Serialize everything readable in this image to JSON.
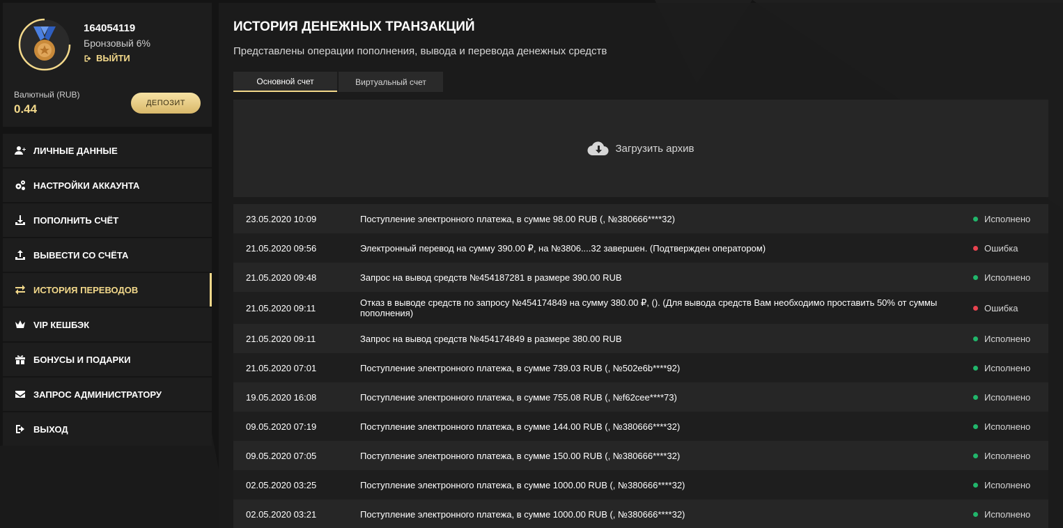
{
  "profile": {
    "user_id": "164054119",
    "level": "Бронзовый 6%",
    "logout_label": "ВЫЙТИ",
    "balance_label": "Валютный (RUB)",
    "balance_value": "0.44",
    "deposit_label": "ДЕПОЗИТ"
  },
  "menu": [
    {
      "label": "ЛИЧНЫЕ ДАННЫЕ",
      "icon": "user-plus-icon"
    },
    {
      "label": "НАСТРОЙКИ АККАУНТА",
      "icon": "gears-icon"
    },
    {
      "label": "ПОПОЛНИТЬ СЧЁТ",
      "icon": "download-icon"
    },
    {
      "label": "ВЫВЕСТИ СО СЧЁТА",
      "icon": "upload-icon"
    },
    {
      "label": "ИСТОРИЯ ПЕРЕВОДОВ",
      "icon": "exchange-icon",
      "active": true
    },
    {
      "label": "VIP КЕШБЭК",
      "icon": "crown-icon"
    },
    {
      "label": "БОНУСЫ И ПОДАРКИ",
      "icon": "gift-icon"
    },
    {
      "label": "ЗАПРОС АДМИНИСТРАТОРУ",
      "icon": "envelope-icon"
    },
    {
      "label": "ВЫХОД",
      "icon": "sign-out-icon"
    }
  ],
  "main": {
    "title": "ИСТОРИЯ ДЕНЕЖНЫХ ТРАНЗАКЦИЙ",
    "subtitle": "Представлены операции пополнения, вывода и перевода денежных средств",
    "tabs": [
      {
        "label": "Основной счет",
        "active": true
      },
      {
        "label": "Виртуальный счет",
        "active": false
      }
    ],
    "archive_label": "Загрузить архив"
  },
  "status_colors": {
    "success": "#21b66b",
    "error": "#e8434f"
  },
  "transactions": [
    {
      "date": "23.05.2020 10:09",
      "desc": "Поступление электронного платежа, в сумме 98.00 RUB (, №380666****32)",
      "status": "Исполнено",
      "kind": "success"
    },
    {
      "date": "21.05.2020 09:56",
      "desc": "Электронный перевод на сумму 390.00 ₽, на №3806....32 завершен. (Подтвержден оператором)",
      "status": "Ошибка",
      "kind": "error"
    },
    {
      "date": "21.05.2020 09:48",
      "desc": "Запрос на вывод средств №454187281 в размере 390.00 RUB",
      "status": "Исполнено",
      "kind": "success"
    },
    {
      "date": "21.05.2020 09:11",
      "desc": "Отказ в выводе средств по запросу №454174849 на сумму 380.00 ₽, (). (Для вывода средств Вам необходимо проставить 50% от суммы пополнения)",
      "status": "Ошибка",
      "kind": "error",
      "tall": true
    },
    {
      "date": "21.05.2020 09:11",
      "desc": "Запрос на вывод средств №454174849 в размере 380.00 RUB",
      "status": "Исполнено",
      "kind": "success"
    },
    {
      "date": "21.05.2020 07:01",
      "desc": "Поступление электронного платежа, в сумме 739.03 RUB (, №502e6b****92)",
      "status": "Исполнено",
      "kind": "success"
    },
    {
      "date": "19.05.2020 16:08",
      "desc": "Поступление электронного платежа, в сумме 755.08 RUB (, №f62cee****73)",
      "status": "Исполнено",
      "kind": "success"
    },
    {
      "date": "09.05.2020 07:19",
      "desc": "Поступление электронного платежа, в сумме 144.00 RUB (, №380666****32)",
      "status": "Исполнено",
      "kind": "success"
    },
    {
      "date": "09.05.2020 07:05",
      "desc": "Поступление электронного платежа, в сумме 150.00 RUB (, №380666****32)",
      "status": "Исполнено",
      "kind": "success"
    },
    {
      "date": "02.05.2020 03:25",
      "desc": "Поступление электронного платежа, в сумме 1000.00 RUB (, №380666****32)",
      "status": "Исполнено",
      "kind": "success"
    },
    {
      "date": "02.05.2020 03:21",
      "desc": "Поступление электронного платежа, в сумме 1000.00 RUB (, №380666****32)",
      "status": "Исполнено",
      "kind": "success"
    }
  ]
}
